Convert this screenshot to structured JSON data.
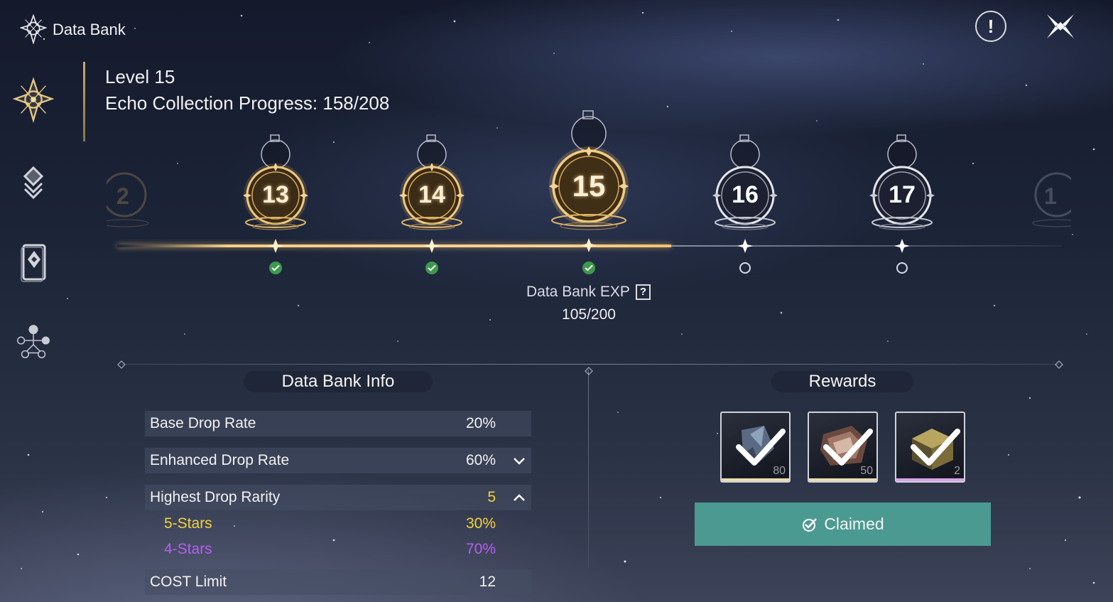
{
  "header": {
    "title": "Data Bank",
    "info_icon": "exclamation-icon",
    "close_icon": "close-cross-icon"
  },
  "sidebar": {
    "items": [
      {
        "name": "data-bank",
        "icon": "star-compass-icon",
        "active": true
      },
      {
        "name": "echo-list",
        "icon": "diamond-layers-icon",
        "active": false
      },
      {
        "name": "echo-cards",
        "icon": "card-diamond-icon",
        "active": false
      },
      {
        "name": "sonata-effects",
        "icon": "constellation-icon",
        "active": false
      }
    ]
  },
  "summary": {
    "level": "Level 15",
    "progress": "Echo Collection Progress: 158/208"
  },
  "levels": {
    "edge_left": "2",
    "edge_right": "1",
    "nodes": [
      {
        "num": "13",
        "state": "claimed"
      },
      {
        "num": "14",
        "state": "claimed"
      },
      {
        "num": "15",
        "state": "current"
      },
      {
        "num": "16",
        "state": "locked"
      },
      {
        "num": "17",
        "state": "locked"
      }
    ]
  },
  "exp": {
    "label": "Data Bank EXP",
    "help": "?",
    "value": "105/200"
  },
  "info": {
    "title": "Data Bank Info",
    "base_drop": {
      "label": "Base Drop Rate",
      "value": "20%"
    },
    "enhanced_drop": {
      "label": "Enhanced Drop Rate",
      "value": "60%"
    },
    "highest_rarity": {
      "label": "Highest Drop Rarity",
      "value": "5"
    },
    "five_star": {
      "label": "5-Stars",
      "value": "30%"
    },
    "four_star": {
      "label": "4-Stars",
      "value": "70%"
    },
    "cost_limit": {
      "label": "COST Limit",
      "value": "12"
    }
  },
  "rewards": {
    "title": "Rewards",
    "items": [
      {
        "name": "crystal-shard",
        "count": "80",
        "bar_color": "#e8dcb0"
      },
      {
        "name": "tuner-box",
        "count": "50",
        "bar_color": "#e8dcb0"
      },
      {
        "name": "golden-cube",
        "count": "2",
        "bar_color": "#d9a2e8"
      }
    ],
    "claimed_label": "Claimed"
  },
  "colors": {
    "gold": "#f6cf86",
    "five_star": "#f3d23c",
    "four_star": "#b55ef0",
    "claimed_btn": "#4b9a92",
    "check_green": "#3d9a4c"
  }
}
